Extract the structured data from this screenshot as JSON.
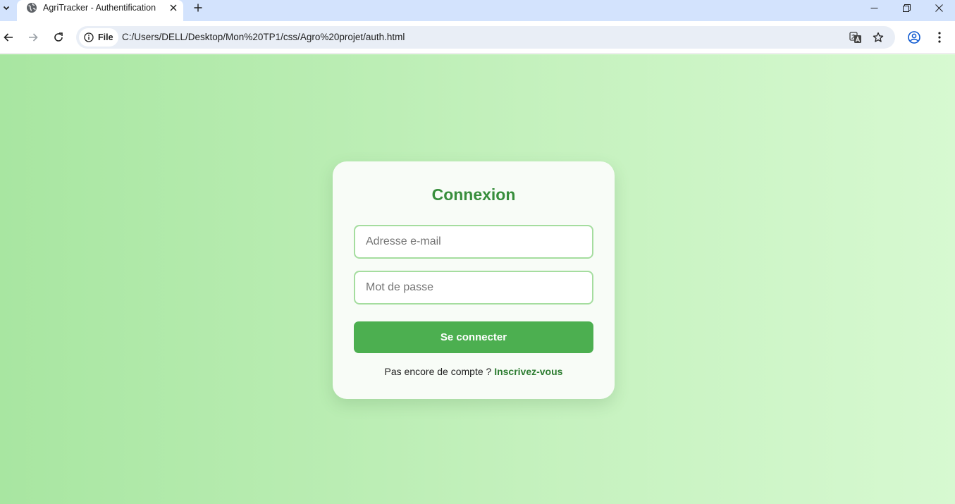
{
  "browser": {
    "tab": {
      "title": "AgriTracker - Authentification"
    },
    "address_bar": {
      "chip_label": "File",
      "url": "C:/Users/DELL/Desktop/Mon%20TP1/css/Agro%20projet/auth.html"
    }
  },
  "login": {
    "title": "Connexion",
    "email_placeholder": "Adresse e-mail",
    "email_value": "",
    "password_placeholder": "Mot de passe",
    "password_value": "",
    "submit_label": "Se connecter",
    "signup_prompt": "Pas encore de compte ? ",
    "signup_link": "Inscrivez-vous"
  },
  "colors": {
    "accent": "#4caf50",
    "title": "#388e3c",
    "link": "#2e7d32",
    "input_border": "#a5dd9f",
    "background_start": "#a8e6a1",
    "background_end": "#d7f9d1"
  },
  "icons": {
    "tab_menu": "chevron-down-icon",
    "favicon": "globe-icon",
    "tab_close": "close-icon",
    "new_tab": "plus-icon",
    "back": "arrow-left-icon",
    "forward": "arrow-right-icon",
    "reload": "reload-icon",
    "site_info": "info-icon",
    "translate": "translate-icon",
    "bookmark": "star-icon",
    "profile": "profile-icon",
    "menu": "more-vertical-icon"
  }
}
